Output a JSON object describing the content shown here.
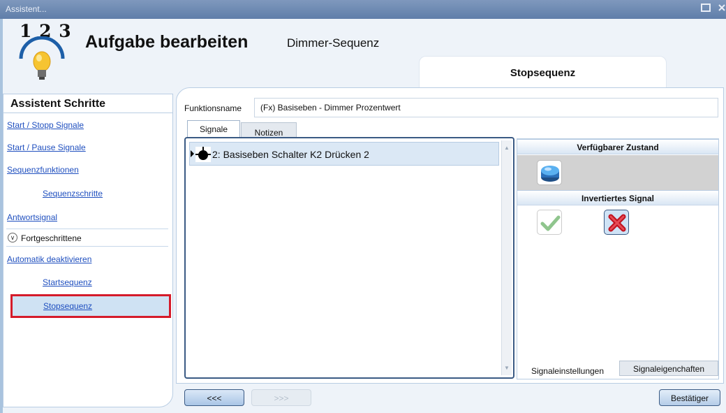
{
  "window": {
    "title": "Assistent..."
  },
  "logo": {
    "numbers": "1 2 3"
  },
  "header": {
    "title": "Aufgabe bearbeiten",
    "subtitle": "Dimmer-Sequenz",
    "tab": "Stopsequenz"
  },
  "steps": {
    "heading": "Assistent Schritte",
    "items": [
      {
        "label": "Start / Stopp Signale"
      },
      {
        "label": "Start / Pause Signale"
      },
      {
        "label": "Sequenzfunktionen"
      },
      {
        "label": "Sequenzschritte"
      },
      {
        "label": "Antwortsignal"
      },
      {
        "label": "Automatik deaktivieren"
      },
      {
        "label": "Startsequenz"
      },
      {
        "label": "Stopsequenz"
      }
    ],
    "advanced_label": "Fortgeschrittene"
  },
  "function": {
    "label": "Funktionsname",
    "value": "(Fx) Basiseben - Dimmer Prozentwert"
  },
  "tabs": [
    {
      "label": "Signale"
    },
    {
      "label": "Notizen"
    }
  ],
  "signals": [
    {
      "label": "2: Basiseben Schalter K2 Drücken 2"
    }
  ],
  "properties": {
    "available_state": "Verfügbarer Zustand",
    "inverted_signal": "Invertiertes Signal",
    "bottom_tabs": [
      {
        "label": "Signaleinstellungen"
      },
      {
        "label": "Signaleigenchaften"
      }
    ]
  },
  "buttons": {
    "prev": "<<<",
    "next": ">>>",
    "confirm": "Bestätiger"
  },
  "colors": {
    "selected_border": "#d51b2a",
    "link": "#1f4fbf",
    "titlebar": "#6f8bb4"
  }
}
